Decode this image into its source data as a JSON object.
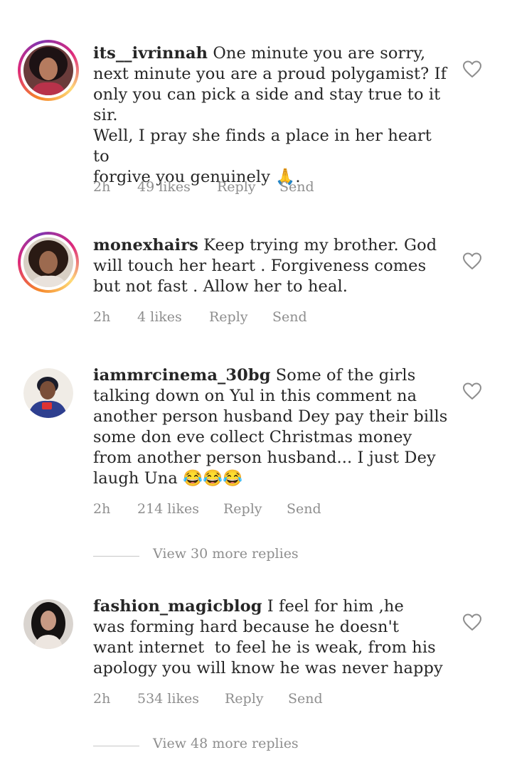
{
  "comments": [
    {
      "username": "its__ivrinnah",
      "text": " One minute you are sorry,\nnext minute you are a proud polygamist? If\nonly you can pick a side and stay true to it\nsir.\nWell, I pray she finds a place in her heart to\nforgive you genuinely 🙏.",
      "time": "2h",
      "likes": "49 likes",
      "reply": "Reply",
      "send": "Send"
    },
    {
      "username": "monexhairs",
      "text": " Keep trying my brother. God\nwill touch her heart . Forgiveness comes\nbut not fast . Allow her to heal.",
      "time": "2h",
      "likes": "4 likes",
      "reply": "Reply",
      "send": "Send"
    },
    {
      "username": "iammrcinema_30bg",
      "text": " Some of the girls\ntalking down on Yul in this comment na\nanother person husband Dey pay their bills\nsome don eve collect Christmas money\nfrom another person husband... I just Dey\nlaugh Una 😂😂😂",
      "time": "2h",
      "likes": "214 likes",
      "reply": "Reply",
      "send": "Send",
      "view_more": "View 30 more replies"
    },
    {
      "username": "fashion_magicblog",
      "text": " I feel for him ,he\nwas forming hard because he doesn't\nwant internet  to feel he is weak, from his\napology you will know he was never happy",
      "time": "2h",
      "likes": "534 likes",
      "reply": "Reply",
      "send": "Send",
      "view_more": "View 48 more replies"
    }
  ],
  "colors": {
    "text": "#262626",
    "secondary": "#8e8e8e",
    "divider": "#c7c7c7",
    "story_ring": [
      "#f58529",
      "#dd2a7b",
      "#8134af"
    ]
  },
  "icons": {
    "like": "heart-outline-icon"
  }
}
